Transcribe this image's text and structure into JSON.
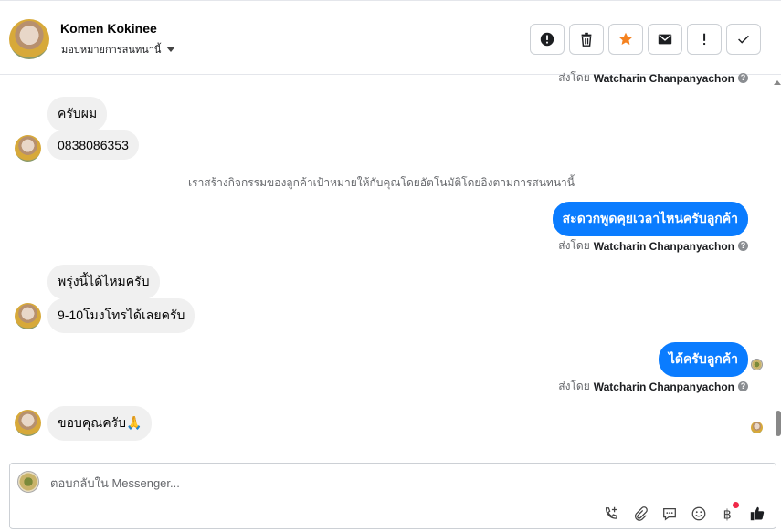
{
  "header": {
    "contact_name": "Komen Kokinee",
    "assign_label": "มอบหมายการสนทนานี้",
    "toolbar": [
      {
        "name": "spam-button",
        "icon": "alert-circle-icon"
      },
      {
        "name": "delete-button",
        "icon": "trash-icon"
      },
      {
        "name": "star-button",
        "icon": "star-icon"
      },
      {
        "name": "mark-unread-button",
        "icon": "envelope-icon"
      },
      {
        "name": "follow-up-button",
        "icon": "exclamation-icon"
      },
      {
        "name": "mark-done-button",
        "icon": "check-icon"
      }
    ]
  },
  "messages": {
    "sent_by_top": {
      "prefix": "ส่งโดย",
      "name": "Watcharin Chanpanyachon"
    },
    "in_1": "ครับผม",
    "in_2": "0838086353",
    "system_1": "เราสร้างกิจกรรมของลูกค้าเป้าหมายให้กับคุณโดยอัตโนมัติโดยอิงตามการสนทนานี้",
    "out_1": "สะดวกพูดคุยเวลาไหนครับลูกค้า",
    "sent_by_1": {
      "prefix": "ส่งโดย",
      "name": "Watcharin Chanpanyachon"
    },
    "in_3": "พรุ่งนี้ได้ไหมครับ",
    "in_4": "9-10โมงโทรได้เลยครับ",
    "out_2": "ได้ครับลูกค้า",
    "sent_by_2": {
      "prefix": "ส่งโดย",
      "name": "Watcharin Chanpanyachon"
    },
    "in_5": "ขอบคุณครับ🙏"
  },
  "composer": {
    "placeholder": "ตอบกลับใน Messenger...",
    "tools": [
      "call-add-icon",
      "paperclip-icon",
      "chat-bubble-icon",
      "emoji-icon",
      "baht-icon",
      "thumbs-up-icon"
    ]
  },
  "colors": {
    "accent": "#0a7cff",
    "star": "#f5821f",
    "notification": "#f02849"
  }
}
